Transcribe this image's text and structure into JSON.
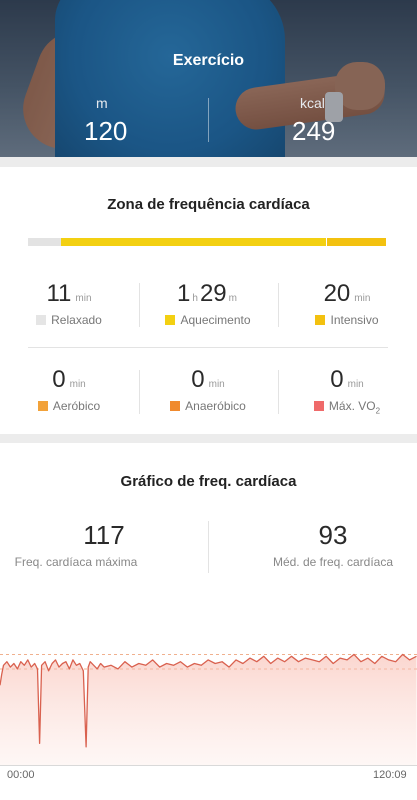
{
  "hero": {
    "title": "Exercício",
    "left": {
      "unit": "m",
      "value": "120"
    },
    "right": {
      "unit": "kcal",
      "value": "249"
    }
  },
  "zones": {
    "title": "Zona de frequência cardíaca",
    "bar_colors": [
      "#e3e3e3",
      "#f3d012",
      "#f3c10f"
    ],
    "items": [
      {
        "value": "11",
        "unit": "min",
        "label": "Relaxado",
        "color": "#e5e5e5"
      },
      {
        "hours": "1",
        "h_unit": "h",
        "minutes": "29",
        "m_unit": "m",
        "label": "Aquecimento",
        "color": "#f3d012"
      },
      {
        "value": "20",
        "unit": "min",
        "label": "Intensivo",
        "color": "#f3c10f"
      },
      {
        "value": "0",
        "unit": "min",
        "label": "Aeróbico",
        "color": "#f2a23a"
      },
      {
        "value": "0",
        "unit": "min",
        "label": "Anaeróbico",
        "color": "#f08a2e"
      },
      {
        "value": "0",
        "unit": "min",
        "label": "Máx. VO",
        "label_sub": "2",
        "color": "#ef6a6a"
      }
    ]
  },
  "hr_chart": {
    "title": "Gráfico de freq. cardíaca",
    "max": {
      "value": "117",
      "label": "Freq. cardíaca máxima"
    },
    "avg": {
      "value": "93",
      "label": "Méd. de freq. cardíaca"
    },
    "x_start": "00:00",
    "x_end": "120:09"
  },
  "chart_data": {
    "type": "line",
    "title": "Gráfico de freq. cardíaca",
    "xlabel": "",
    "ylabel": "",
    "xlim": [
      0,
      120.15
    ],
    "ylim": [
      40,
      120
    ],
    "reference_lines": [
      117,
      93
    ],
    "x_tick_labels": [
      "00:00",
      "120:09"
    ],
    "series": [
      {
        "color": "#d9614f",
        "x": [
          0,
          0.5,
          1,
          2,
          3,
          4,
          5,
          6,
          7,
          8,
          9,
          10,
          10.8,
          11.4,
          12,
          13,
          14,
          15,
          16,
          17,
          18,
          19,
          20,
          21,
          22,
          23,
          24,
          24.8,
          25.4,
          26,
          27,
          28,
          29,
          30,
          32,
          34,
          36,
          38,
          40,
          42,
          44,
          46,
          48,
          50,
          52,
          54,
          56,
          58,
          60,
          62,
          64,
          66,
          68,
          70,
          72,
          74,
          76,
          78,
          80,
          82,
          84,
          86,
          88,
          90,
          92,
          94,
          96,
          98,
          100,
          102,
          104,
          106,
          108,
          110,
          112,
          114,
          116,
          118,
          120
        ],
        "y": [
          84,
          90,
          95,
          97,
          94,
          96,
          93,
          97,
          95,
          98,
          94,
          96,
          93,
          52,
          95,
          97,
          92,
          96,
          98,
          94,
          96,
          97,
          93,
          98,
          95,
          96,
          92,
          50,
          94,
          97,
          95,
          93,
          96,
          94,
          95,
          93,
          97,
          94,
          96,
          95,
          98,
          94,
          96,
          95,
          97,
          94,
          96,
          95,
          98,
          96,
          97,
          94,
          98,
          96,
          99,
          97,
          100,
          96,
          99,
          97,
          100,
          97,
          99,
          98,
          97,
          100,
          96,
          99,
          98,
          101,
          97,
          99,
          96,
          100,
          98,
          97,
          101,
          98,
          100
        ]
      }
    ]
  }
}
